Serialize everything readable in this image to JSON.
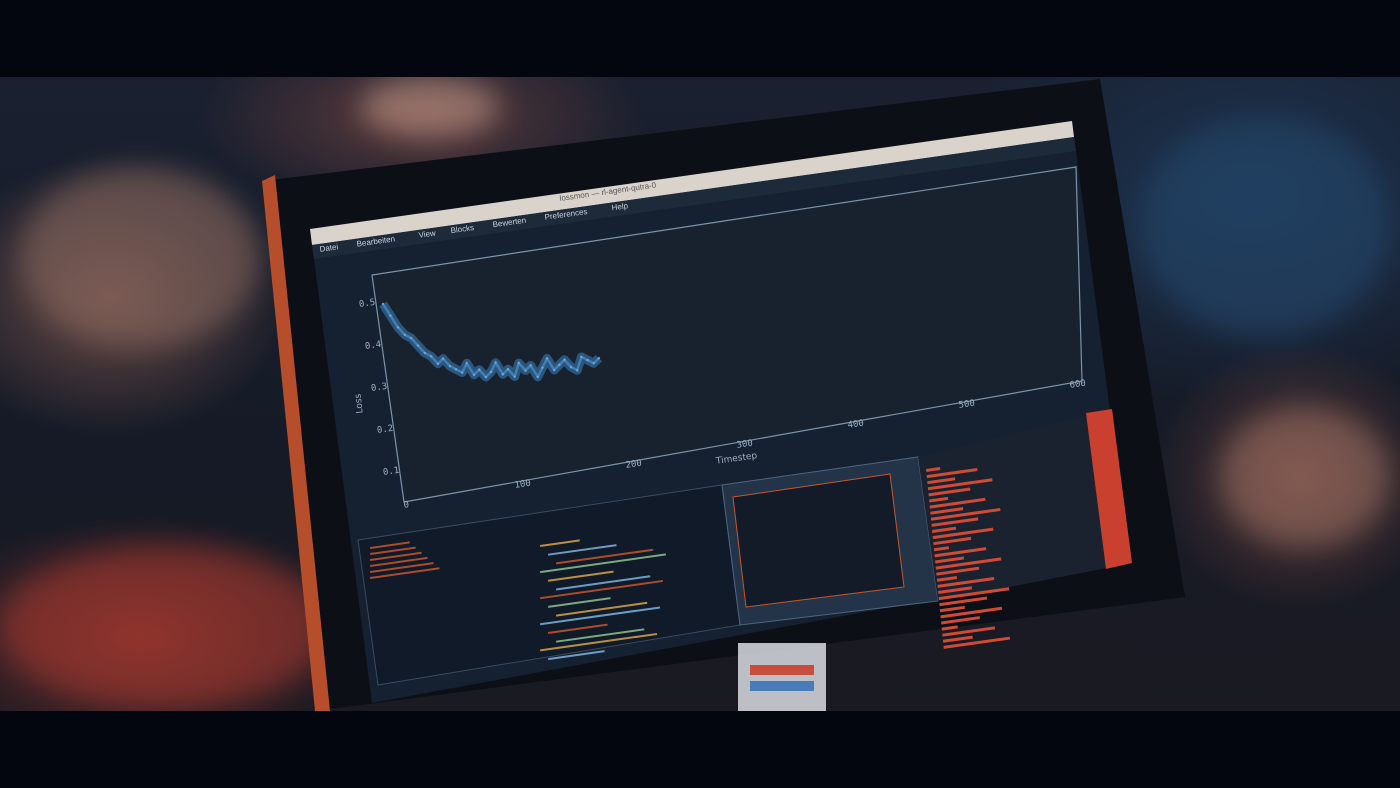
{
  "window": {
    "title": "lossmon — rl-agent-qutra-0",
    "menu": [
      "Datei",
      "Bearbeiten",
      "View",
      "Blocks",
      "Bewerten",
      "Preferences",
      "Help"
    ]
  },
  "chart_data": {
    "type": "line",
    "title": "",
    "xlabel": "Timestep",
    "ylabel": "Loss",
    "xlim": [
      0,
      600
    ],
    "ylim": [
      0.05,
      0.55
    ],
    "x_ticks": [
      "0",
      "100",
      "200",
      "300",
      "400",
      "500",
      "600"
    ],
    "y_ticks": [
      "0.1",
      "0.2",
      "0.3",
      "0.4",
      "0.5"
    ],
    "grid": false,
    "series": [
      {
        "name": "",
        "color": "#3f7fb8",
        "x": [
          0,
          5,
          10,
          15,
          20,
          25,
          30,
          35,
          40,
          45,
          50,
          55,
          60,
          65,
          70,
          75,
          80,
          85,
          90,
          95,
          100,
          105,
          110,
          115,
          120,
          125,
          130,
          135,
          140,
          145,
          150,
          155,
          160,
          165,
          170,
          175,
          180
        ],
        "y": [
          0.5,
          0.47,
          0.44,
          0.42,
          0.41,
          0.39,
          0.37,
          0.36,
          0.34,
          0.35,
          0.33,
          0.32,
          0.31,
          0.33,
          0.3,
          0.31,
          0.29,
          0.3,
          0.32,
          0.29,
          0.3,
          0.28,
          0.31,
          0.29,
          0.3,
          0.27,
          0.29,
          0.31,
          0.28,
          0.29,
          0.3,
          0.28,
          0.27,
          0.3,
          0.29,
          0.28,
          0.29
        ]
      }
    ]
  },
  "colors": {
    "plot_bg": "#1a2434",
    "line": "#3f7fb8",
    "frame": "#c9552e",
    "bars": "#d04a35"
  }
}
